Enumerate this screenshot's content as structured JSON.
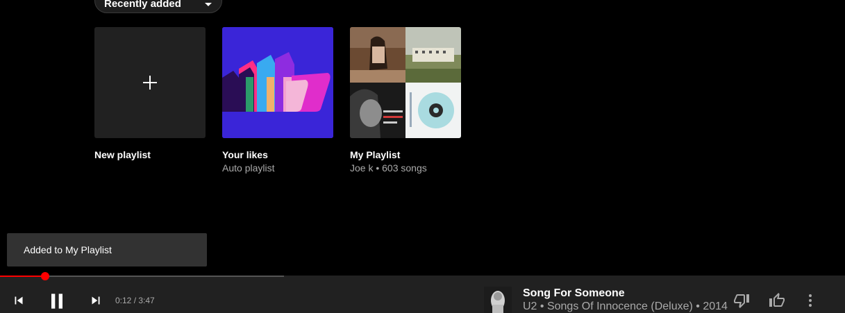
{
  "sort": {
    "selected": "Recently added"
  },
  "playlists": [
    {
      "title": "New playlist",
      "subtitle": ""
    },
    {
      "title": "Your likes",
      "subtitle": "Auto playlist"
    },
    {
      "title": "My Playlist",
      "subtitle": "Joe k • 603 songs"
    }
  ],
  "toast": {
    "message": "Added to My Playlist"
  },
  "player": {
    "time": "0:12 / 3:47",
    "progress_fraction": 0.053,
    "track_title": "Song For Someone",
    "track_meta": "U2 • Songs Of Innocence (Deluxe) • 2014"
  },
  "colors": {
    "progress": "#ff0000",
    "likes_background": "#3a25d8"
  },
  "icons": {
    "previous": "skip-previous-icon",
    "pause": "pause-icon",
    "next": "skip-next-icon",
    "dislike": "thumb-down-icon",
    "like": "thumb-up-icon",
    "menu": "more-vert-icon",
    "plus": "plus-icon"
  }
}
